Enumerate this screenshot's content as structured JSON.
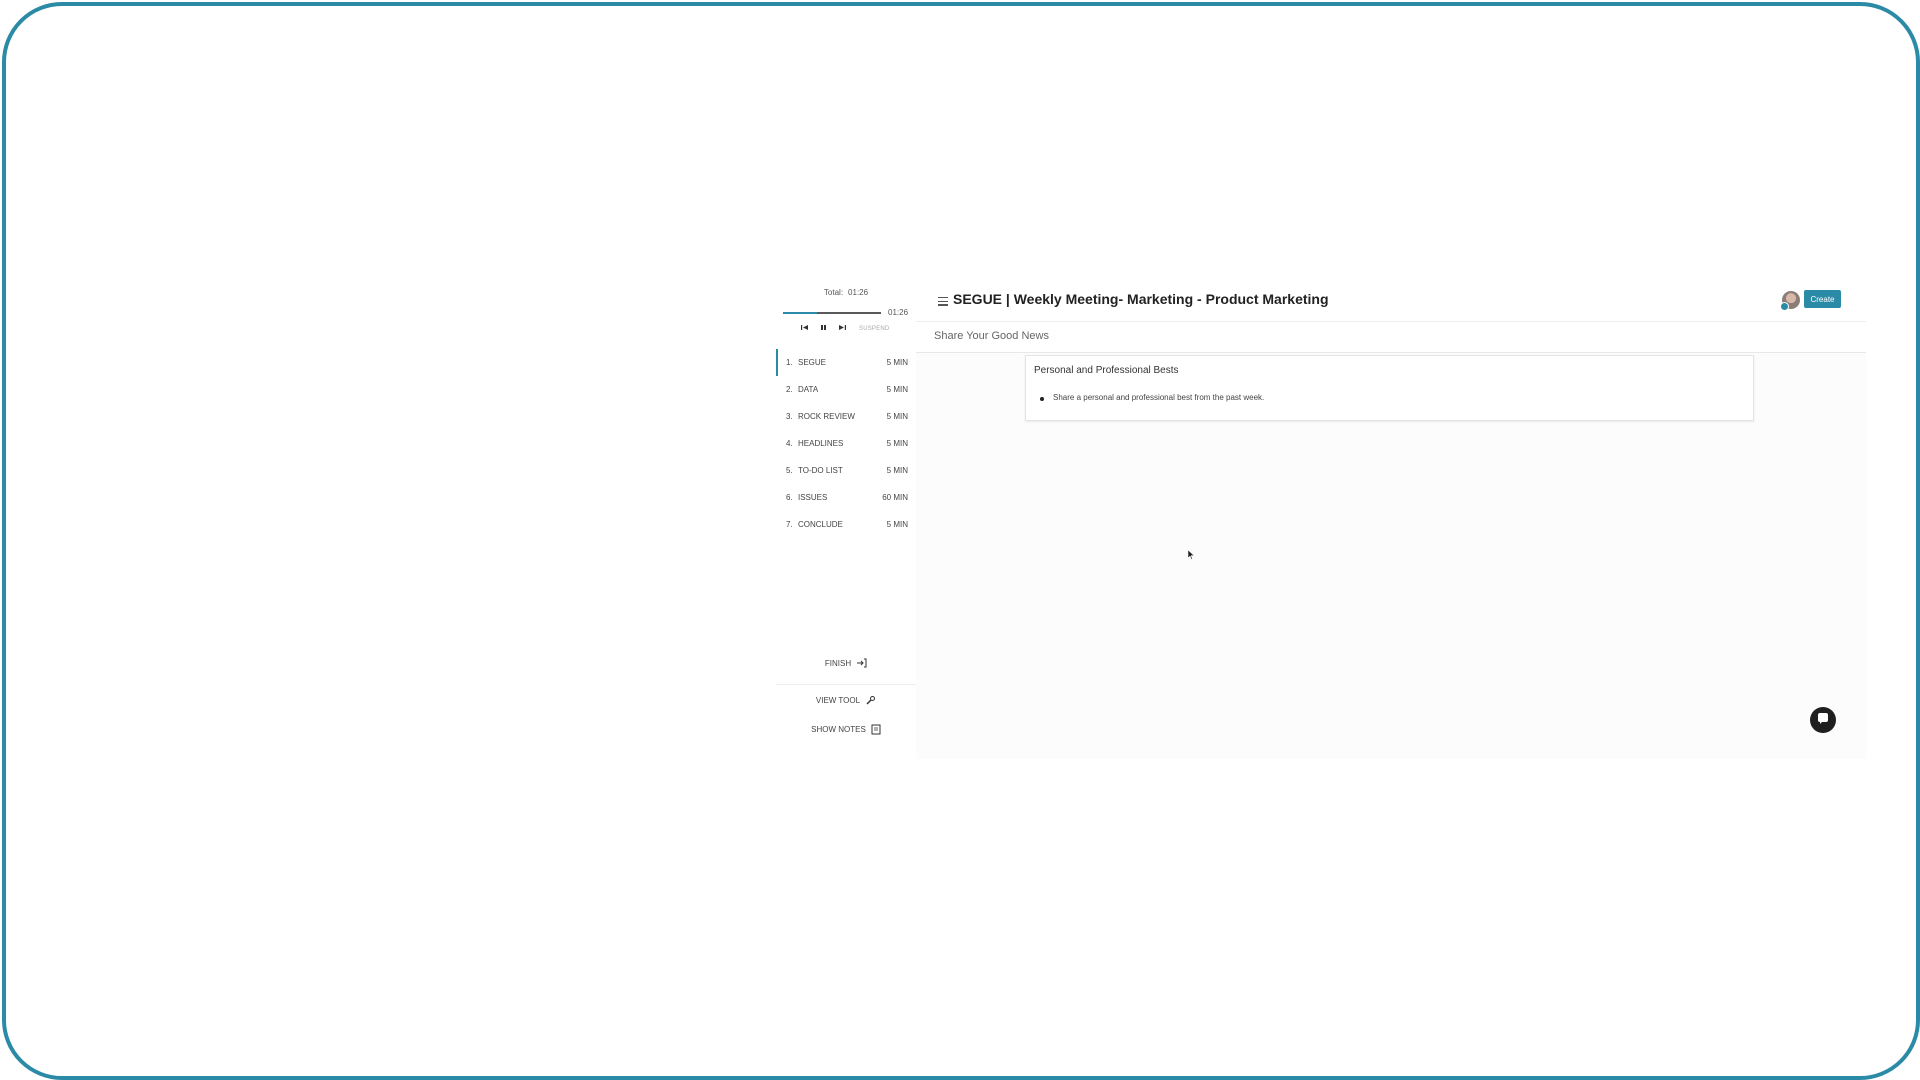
{
  "timer": {
    "total_label": "Total:",
    "total_value": "01:26",
    "elapsed": "01:26",
    "progress_fraction": 0.35,
    "suspend_label": "SUSPEND"
  },
  "agenda": [
    {
      "num": "1.",
      "label": "SEGUE",
      "duration": "5 MIN",
      "active": true
    },
    {
      "num": "2.",
      "label": "DATA",
      "duration": "5 MIN",
      "active": false
    },
    {
      "num": "3.",
      "label": "ROCK REVIEW",
      "duration": "5 MIN",
      "active": false
    },
    {
      "num": "4.",
      "label": "HEADLINES",
      "duration": "5 MIN",
      "active": false
    },
    {
      "num": "5.",
      "label": "TO-DO LIST",
      "duration": "5 MIN",
      "active": false
    },
    {
      "num": "6.",
      "label": "ISSUES",
      "duration": "60 MIN",
      "active": false
    },
    {
      "num": "7.",
      "label": "CONCLUDE",
      "duration": "5 MIN",
      "active": false
    }
  ],
  "sidebar_actions": {
    "finish": "FINISH",
    "view_tool": "VIEW TOOL",
    "show_notes": "SHOW  NOTES"
  },
  "header": {
    "title": "SEGUE | Weekly Meeting- Marketing - Product Marketing",
    "create_label": "Create"
  },
  "subheader": {
    "title": "Share Your Good News"
  },
  "card": {
    "title": "Personal and Professional Bests",
    "bullet": "Share a personal and professional best from the past week."
  },
  "colors": {
    "accent": "#2b8aa6",
    "frame": "#2b8aa6",
    "chat_button": "#1f1f1f"
  },
  "icons": [
    "prev-icon",
    "pause-icon",
    "next-icon",
    "menu-icon",
    "finish-exit-icon",
    "wrench-icon",
    "notes-icon",
    "chat-icon",
    "mouse-cursor-icon"
  ]
}
